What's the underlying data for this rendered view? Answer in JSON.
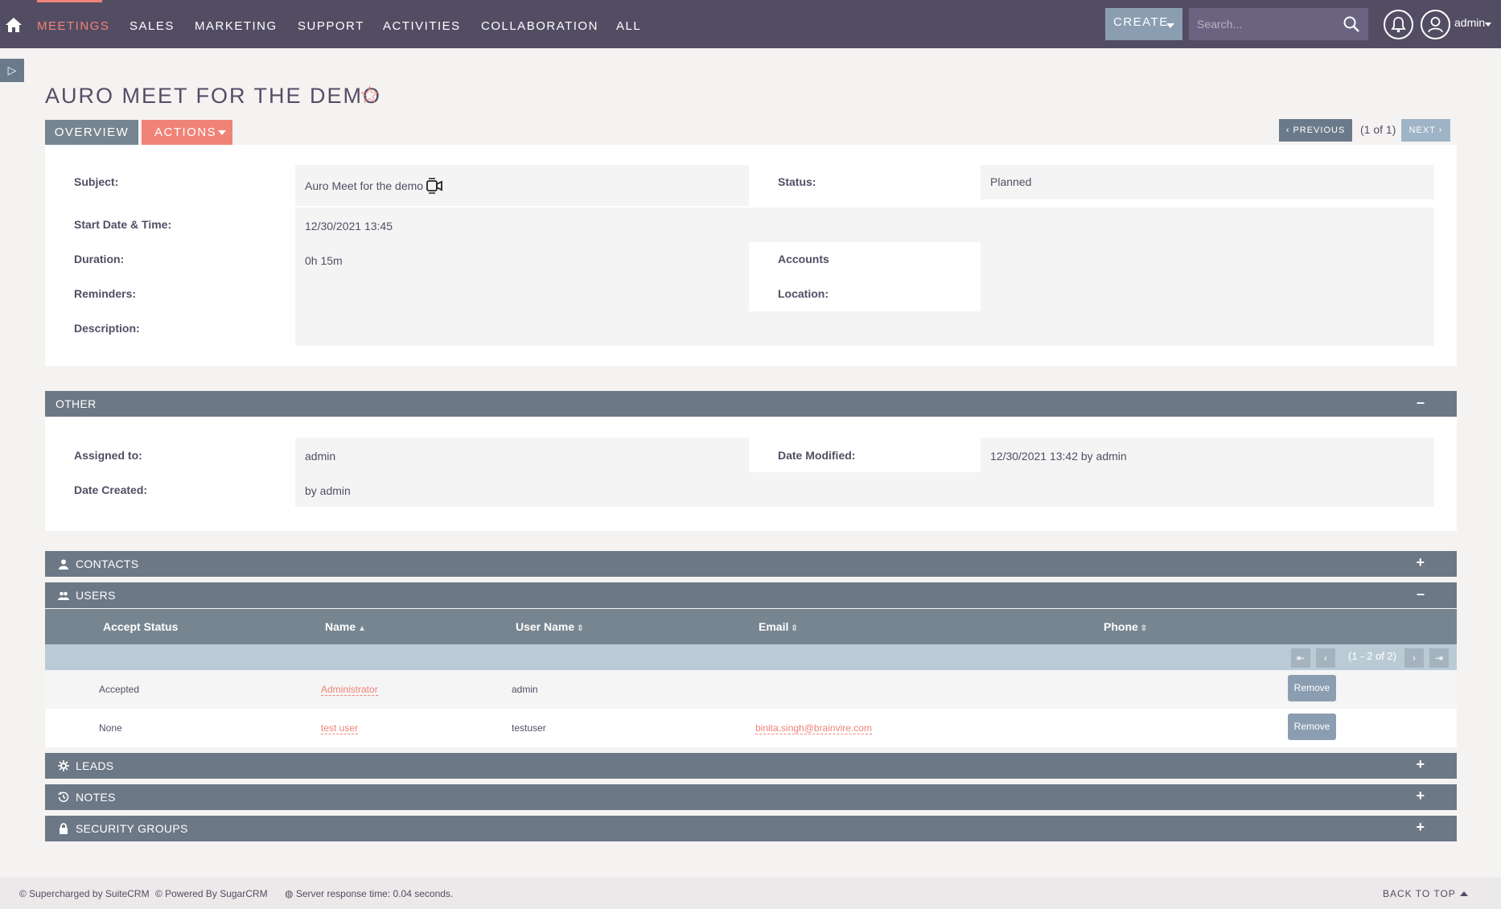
{
  "nav": {
    "items": [
      "MEETINGS",
      "SALES",
      "MARKETING",
      "SUPPORT",
      "ACTIVITIES",
      "COLLABORATION",
      "ALL"
    ],
    "active": "MEETINGS",
    "create_label": "CREATE",
    "search_placeholder": "Search...",
    "user_name": "admin"
  },
  "page": {
    "title": "AURO MEET FOR THE DEMO",
    "tabs": {
      "overview": "OVERVIEW",
      "actions": "ACTIONS"
    },
    "pagination": {
      "previous": "PREVIOUS",
      "count": "(1 of 1)",
      "next": "NEXT"
    }
  },
  "overview": {
    "subject_label": "Subject:",
    "subject_value": "Auro Meet for the demo",
    "status_label": "Status:",
    "status_value": "Planned",
    "start_label": "Start Date & Time:",
    "start_value": "12/30/2021 13:45",
    "duration_label": "Duration:",
    "duration_value": "0h 15m",
    "accounts_label": "Accounts",
    "accounts_value": "",
    "reminders_label": "Reminders:",
    "reminders_value": "",
    "location_label": "Location:",
    "location_value": "",
    "description_label": "Description:",
    "description_value": ""
  },
  "other": {
    "title": "OTHER",
    "assigned_label": "Assigned to:",
    "assigned_value": "admin",
    "modified_label": "Date Modified:",
    "modified_value": "12/30/2021 13:42 by admin",
    "created_label": "Date Created:",
    "created_value": "by admin"
  },
  "subpanels": {
    "contacts": "CONTACTS",
    "users": "USERS",
    "leads": "LEADS",
    "notes": "NOTES",
    "security_groups": "SECURITY GROUPS"
  },
  "users_table": {
    "columns": [
      "Accept Status",
      "Name",
      "User Name",
      "Email",
      "Phone"
    ],
    "pager_count": "(1 - 2 of 2)",
    "remove_label": "Remove",
    "rows": [
      {
        "accept_status": "Accepted",
        "name": "Administrator",
        "user_name": "admin",
        "email": "",
        "phone": ""
      },
      {
        "accept_status": "None",
        "name": "test user",
        "user_name": "testuser",
        "email": "binita.singh@brainvire.com",
        "phone": ""
      }
    ]
  },
  "footer": {
    "supercharged": "© Supercharged by SuiteCRM",
    "powered": "© Powered By SugarCRM",
    "server_time": "Server response time: 0.04 seconds.",
    "back_to_top": "BACK TO TOP"
  },
  "colors": {
    "nav_bg": "#534d64",
    "accent": "#f08377",
    "section_bg": "#6c7886",
    "button_blue": "#8b9eb1"
  }
}
